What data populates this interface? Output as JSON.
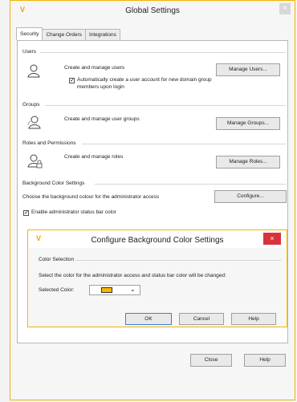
{
  "window": {
    "title": "Global Settings",
    "accent_color": "#f0b400",
    "icon": "app-logo-v-icon",
    "close_glyph": "×"
  },
  "tabs": [
    {
      "label": "Security",
      "active": true
    },
    {
      "label": "Change Orders",
      "active": false
    },
    {
      "label": "Integrations",
      "active": false
    }
  ],
  "users": {
    "group_label": "Users",
    "description": "Create and manage users",
    "button": "Manage Users...",
    "auto_create_line1": "Automatically create a user account for new domain group",
    "auto_create_line2": "members upon login",
    "auto_create_checked": true
  },
  "groups": {
    "group_label": "Groups",
    "description": "Create and manage user groups",
    "button": "Manage Groups..."
  },
  "roles": {
    "group_label": "Roles and Permissions",
    "description": "Create and manage roles",
    "button": "Manage Roles..."
  },
  "bg_color": {
    "group_label": "Background Color Settings",
    "description": "Choose the background colour for the administrator access",
    "button": "Configure...",
    "enable_label": "Enable administrator status bar color",
    "enable_checked": true
  },
  "dialog": {
    "title": "Configure Background Color Settings",
    "close_glyph": "×",
    "close_color": "#d8333b",
    "section_label": "Color Selection",
    "instruction": "Select the color for the administrator access and status bar color will be changed:",
    "selected_label": "Selected Color:",
    "selected_color": "#f6b800",
    "dropdown_glyph": "⌄",
    "ok": "OK",
    "cancel": "Cancel",
    "help": "Help"
  },
  "footer": {
    "close": "Close",
    "help": "Help"
  }
}
